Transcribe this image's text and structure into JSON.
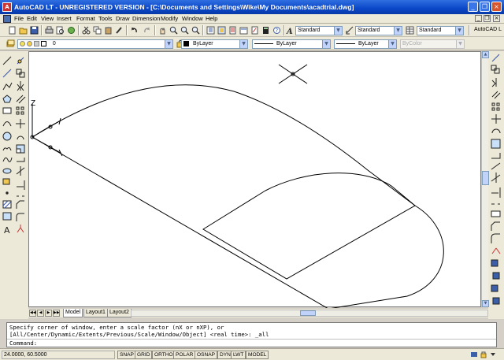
{
  "window": {
    "title": "AutoCAD LT - UNREGISTERED VERSION - [C:\\Documents and Settings\\Wike\\My Documents\\acadtrial.dwg]",
    "minimize": "_",
    "restore": "❐",
    "close": "×"
  },
  "menu": {
    "items": [
      "File",
      "Edit",
      "View",
      "Insert",
      "Format",
      "Tools",
      "Draw",
      "Dimension",
      "Modify",
      "Window",
      "Help"
    ],
    "doc_min": "_",
    "doc_restore": "❐",
    "doc_close": "×"
  },
  "toolbar": {
    "text_style": "Standard",
    "dim_style": "Standard",
    "table_style": "Standard",
    "product_label": "AutoCAD L"
  },
  "properties": {
    "layer": "0",
    "color": "ByLayer",
    "linetype": "ByLayer",
    "lineweight": "ByLayer",
    "plotstyle": "ByColor"
  },
  "ucs": {
    "axis_label": "Z"
  },
  "tabs": {
    "items": [
      "Model",
      "Layout1",
      "Layout2"
    ],
    "active": "Model"
  },
  "command": {
    "history": [
      "Specify corner of window, enter a scale factor (nX or nXP), or",
      "[All/Center/Dynamic/Extents/Previous/Scale/Window/Object] <real time>: _all"
    ],
    "prompt": "Command:"
  },
  "status": {
    "coordinates": "24.0000, 60.5000",
    "toggles": [
      "SNAP",
      "GRID",
      "ORTHO",
      "POLAR",
      "OSNAP",
      "DYN",
      "LWT",
      "MODEL"
    ]
  },
  "colors": {
    "title_blue": "#0a47c8",
    "toolbar_bg": "#ece9d8",
    "canvas_bg": "#ffffff",
    "scroll_blue": "#c1d3fb"
  }
}
